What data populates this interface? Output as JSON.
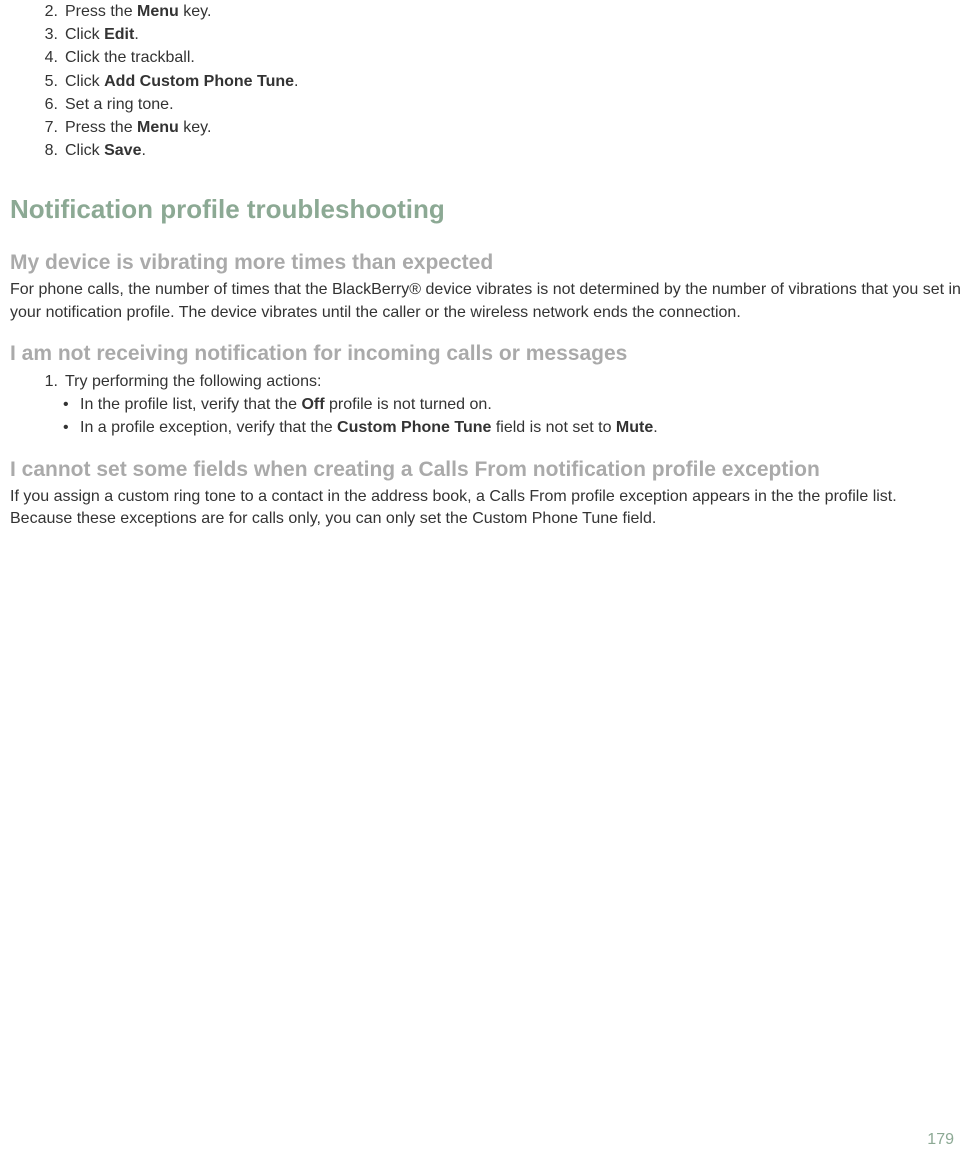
{
  "steps": [
    {
      "num": "2.",
      "pre": "Press the ",
      "bold": "Menu",
      "post": " key."
    },
    {
      "num": "3.",
      "pre": "Click ",
      "bold": "Edit",
      "post": "."
    },
    {
      "num": "4.",
      "pre": "Click the trackball.",
      "bold": "",
      "post": ""
    },
    {
      "num": "5.",
      "pre": "Click ",
      "bold": "Add Custom Phone Tune",
      "post": "."
    },
    {
      "num": "6.",
      "pre": "Set a ring tone.",
      "bold": "",
      "post": ""
    },
    {
      "num": "7.",
      "pre": "Press the ",
      "bold": "Menu",
      "post": " key."
    },
    {
      "num": "8.",
      "pre": "Click ",
      "bold": "Save",
      "post": "."
    }
  ],
  "h1": "Notification profile troubleshooting",
  "section1": {
    "heading": "My device is vibrating more times than expected",
    "para": "For phone calls, the number of times that the BlackBerry® device vibrates is not determined by the number of vibrations that you set in your notification profile. The device vibrates until the caller or the wireless network ends the connection."
  },
  "section2": {
    "heading": "I am not receiving notification for incoming calls or messages",
    "step_num": "1.",
    "step_text": "Try performing the following actions:",
    "bullet1": {
      "pre": "In the profile list, verify that the ",
      "bold": "Off",
      "post": " profile is not turned on."
    },
    "bullet2": {
      "pre": "In a profile exception, verify that the ",
      "bold1": "Custom Phone Tune",
      "mid": " field is not set to ",
      "bold2": "Mute",
      "post": "."
    }
  },
  "section3": {
    "heading": "I cannot set some fields when creating a Calls From notification profile exception",
    "para": "If you assign a custom ring tone to a contact in the address book, a Calls From profile exception appears in the the profile list. Because these exceptions are for calls only, you can only set the Custom Phone Tune field."
  },
  "page_number": "179"
}
